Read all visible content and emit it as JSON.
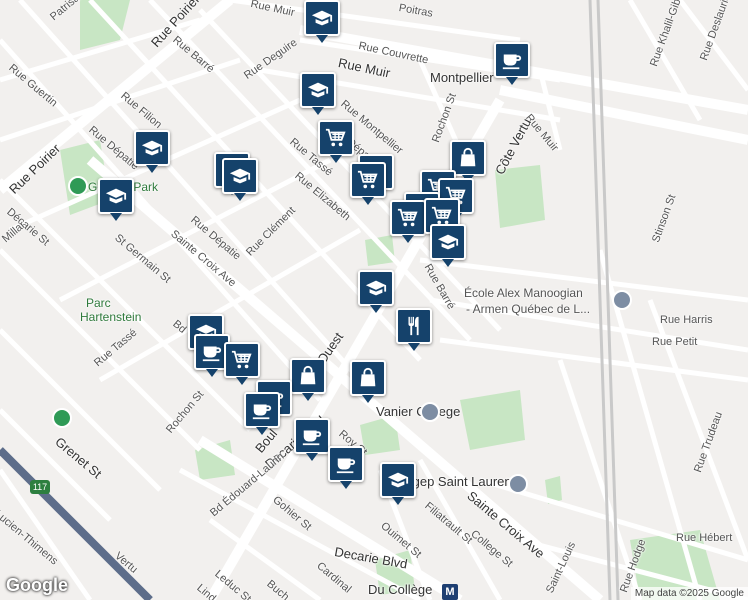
{
  "labels": {
    "rue_muir_top": "Rue Muir",
    "rue_poitras": "Poitras",
    "rue_poirier_top": "Rue Poirier",
    "rue_atrisac": "Patrisac",
    "rue_couvrette": "Rue Couvrette",
    "rue_muir_mid": "Rue Muir",
    "rue_guertin": "Rue Guertin",
    "rue_barre_top": "Rue Barré",
    "rue_deguire": "Rue Deguire",
    "montpellier": "Montpellier",
    "rue_khalil": "Rue Khalil-Gibran",
    "rue_deslauriers": "Rue Deslauriers",
    "rue_filion": "Rue Filion",
    "rue_montpellier": "Rue Montpellier",
    "rochon_st_top": "Rochon St",
    "rue_muir_right": "Rue Muir",
    "rue_depatie_left": "Rue Dépatie",
    "rue_tasse_top": "Rue Tassé",
    "rue_depatie_mid": "Dépatie",
    "cote_vertu": "Côte Vertu",
    "rue_poirier_left": "Rue Poirier",
    "park": "Goyeau Park",
    "rue_elizabeth": "Rue Elizabeth",
    "decarie_top": "Décarie St",
    "st_germain": "St Germain St",
    "sainte_croix_top": "Sainte Croix Ave",
    "rue_depatie_low": "Rue Dépatie",
    "rue_clement": "Rue Clément",
    "stinson": "Stinson St",
    "millar": "Millar",
    "parc_h1": "Parc",
    "parc_h2": "Hartenstein",
    "rue_barre_mid": "Rue Barré",
    "school1": "École Alex Manoogian",
    "school2": "- Armen Québec de L...",
    "rue_harris": "Rue Harris",
    "rue_petit": "Rue Petit",
    "rue_tasse_low": "Rue Tassé",
    "ouest": "Ouest",
    "bd_label": "Bd",
    "rochon_st_low": "Rochon St",
    "vanier": "Vanier College",
    "rue_trudeau": "Rue Trudeau",
    "grenet": "Grenet St",
    "bould": "Boul",
    "roy_st": "Roy St",
    "decarie_blvd": "Decarie Blvd",
    "cegep": "Cégep Saint Laurent",
    "hwy": "117",
    "edouard": "Bd Édouard-Laurin",
    "gohier": "Gohier St",
    "sainte_croix_low": "Sainte Croix Ave",
    "filiatrault": "Filiatrault St",
    "ouimet": "Ouimet St",
    "decarie_blvd2": "Decarie Blvd",
    "college_st": "College St",
    "rue_hebert": "Rue Hébert",
    "rue_hodge": "Rue Hodge",
    "lucien": "Lucien-Thimens",
    "vertu": "Vertu",
    "leduc": "Leduc St",
    "cardinal": "Cardinal",
    "buch": "Buch",
    "linds": "Lind",
    "du_college": "Du Collège",
    "st_louis": "Saint-Louis",
    "metro_m": "M",
    "google": "Google",
    "attribution": "Map data ©2025 Google"
  },
  "colors": {
    "pin": "#15426b",
    "road": "#ffffff",
    "park": "#c8e6c4",
    "rail": "#c9c9c9",
    "highway": "#5d6d8a"
  },
  "pins": [
    {
      "icon": "school-icon"
    },
    {
      "icon": "cafe-icon"
    },
    {
      "icon": "school-icon"
    },
    {
      "icon": "grocery-icon"
    },
    {
      "icon": "school-icon"
    },
    {
      "icon": "school-icon"
    },
    {
      "icon": "school-icon"
    },
    {
      "icon": "grocery-icon"
    },
    {
      "icon": "grocery-icon"
    },
    {
      "icon": "grocery-icon"
    },
    {
      "icon": "shopping-bag-icon"
    },
    {
      "icon": "school-icon"
    },
    {
      "icon": "school-icon"
    },
    {
      "icon": "restaurant-icon"
    },
    {
      "icon": "school-icon"
    },
    {
      "icon": "cafe-icon"
    },
    {
      "icon": "grocery-icon"
    },
    {
      "icon": "shopping-bag-icon"
    },
    {
      "icon": "shopping-bag-icon"
    },
    {
      "icon": "cafe-icon"
    },
    {
      "icon": "cafe-icon"
    },
    {
      "icon": "cafe-icon"
    },
    {
      "icon": "cafe-icon"
    },
    {
      "icon": "school-icon"
    }
  ]
}
